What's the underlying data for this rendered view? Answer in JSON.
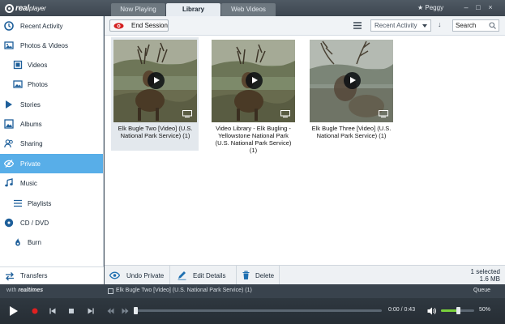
{
  "app": {
    "logo_text": "real",
    "logo_suffix": "player",
    "user": "★ Peggy"
  },
  "tabs": [
    {
      "label": "Now Playing",
      "active": false
    },
    {
      "label": "Library",
      "active": true
    },
    {
      "label": "Web Videos",
      "active": false
    }
  ],
  "sidebar": {
    "items": [
      {
        "label": "Recent Activity",
        "icon": "clock-icon"
      },
      {
        "label": "Photos & Videos",
        "icon": "photos-videos-icon"
      },
      {
        "label": "Videos",
        "icon": "film-icon"
      },
      {
        "label": "Photos",
        "icon": "photo-icon"
      },
      {
        "label": "Stories",
        "icon": "stories-icon"
      },
      {
        "label": "Albums",
        "icon": "albums-icon"
      },
      {
        "label": "Sharing",
        "icon": "people-icon"
      },
      {
        "label": "Private",
        "icon": "eye-slash-icon",
        "selected": true
      },
      {
        "label": "Music",
        "icon": "music-note-icon"
      },
      {
        "label": "Playlists",
        "icon": "list-icon"
      },
      {
        "label": "CD / DVD",
        "icon": "disc-icon"
      },
      {
        "label": "Burn",
        "icon": "flame-icon"
      }
    ],
    "transfers_label": "Transfers"
  },
  "toolbar": {
    "end_session_label": "End Session",
    "sort_value": "Recent Activity",
    "search_placeholder": "Search"
  },
  "videos": [
    {
      "title": "Elk Bugle Two [Video] (U.S. National Park Service) (1)",
      "selected": true
    },
    {
      "title": "Video Library - Elk Bugling - Yellowstone National Park (U.S. National Park Service) (1)",
      "selected": false
    },
    {
      "title": "Elk Bugle Three [Video] (U.S. National Park Service) (1)",
      "selected": false
    }
  ],
  "actions": {
    "undo_private": "Undo Private",
    "edit_details": "Edit Details",
    "delete": "Delete",
    "selected_count": "1 selected",
    "selected_size": "1.6 MB"
  },
  "now_playing": {
    "with_label": "with",
    "brand": "realtimes",
    "title": "Elk Bugle Two [Video] (U.S. National Park Service) (1)",
    "queue_label": "Queue"
  },
  "player": {
    "time": "0:00 / 0:43",
    "progress": 0,
    "volume_percent": 50,
    "volume_label": "50%"
  },
  "colors": {
    "accent": "#58aee8",
    "record": "#e02020",
    "volume": "#7ad13c"
  }
}
